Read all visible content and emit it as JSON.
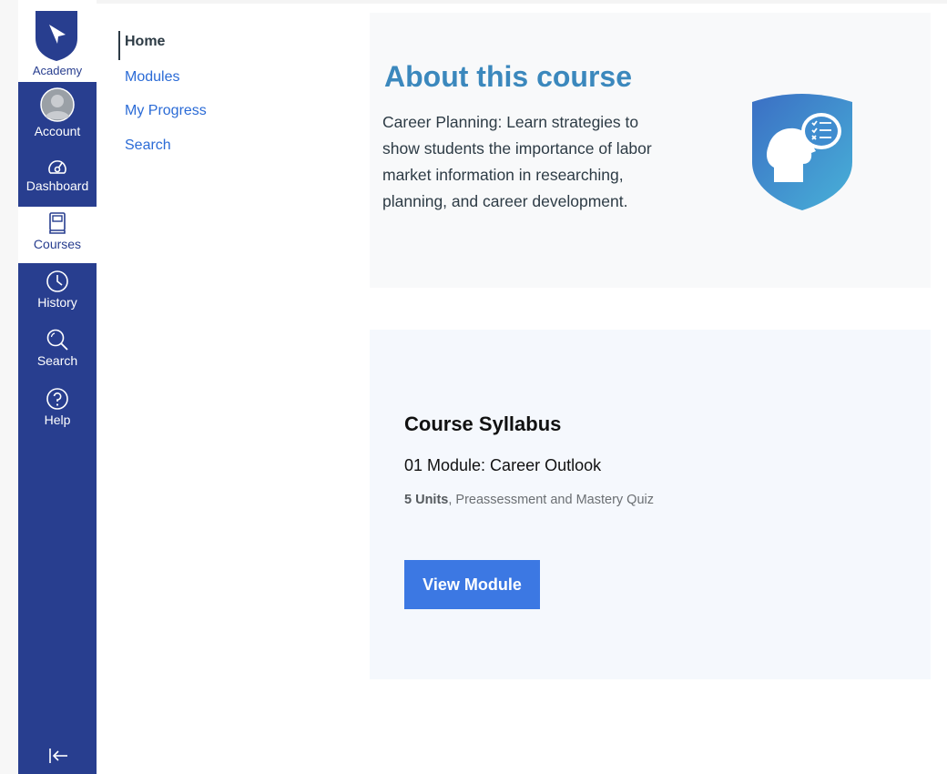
{
  "colors": {
    "nav_bg": "#283e8f",
    "title_blue": "#3b88bd",
    "link_blue": "#2b6bd6",
    "button_blue": "#3c78e3"
  },
  "global_nav": {
    "logo_label": "Academy",
    "items": [
      {
        "label": "Account",
        "icon": "avatar-icon"
      },
      {
        "label": "Dashboard",
        "icon": "dashboard-icon"
      },
      {
        "label": "Courses",
        "icon": "book-icon",
        "active": true
      },
      {
        "label": "History",
        "icon": "clock-icon"
      },
      {
        "label": "Search",
        "icon": "search-icon"
      },
      {
        "label": "Help",
        "icon": "help-icon"
      }
    ],
    "collapse_icon": "collapse-nav-icon"
  },
  "course_nav": {
    "items": [
      {
        "label": "Home",
        "active": true
      },
      {
        "label": "Modules"
      },
      {
        "label": "My Progress"
      },
      {
        "label": "Search"
      }
    ]
  },
  "about": {
    "title": "About this course",
    "description": "Career Planning: Learn strategies to show students the importance of labor market information in researching, planning, and career development.",
    "emblem_icon": "career-shield-icon"
  },
  "syllabus": {
    "title": "Course Syllabus",
    "module_name": "01 Module: Career Outlook",
    "units": "5 Units",
    "details": ", Preassessment and Mastery Quiz",
    "button_label": "View Module"
  }
}
